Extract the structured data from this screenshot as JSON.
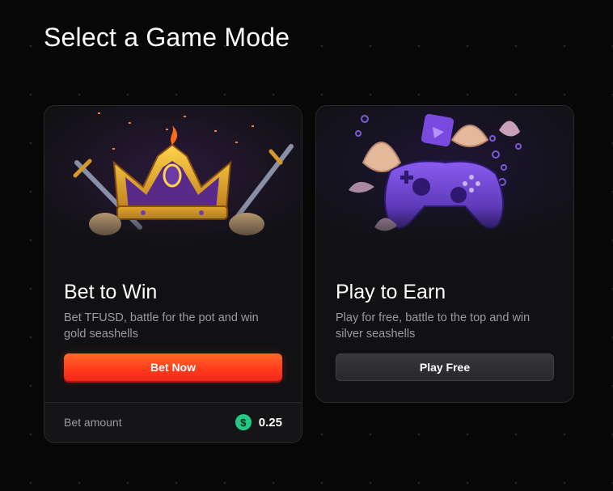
{
  "page": {
    "title": "Select a Game Mode"
  },
  "modes": [
    {
      "title": "Bet to Win",
      "description": "Bet TFUSD, battle for the pot and win gold seashells",
      "button_label": "Bet Now",
      "art": "crown-with-swords-illustration",
      "footer": {
        "label": "Bet amount",
        "value": "0.25",
        "currency_icon": "dollar-coin-icon"
      }
    },
    {
      "title": "Play to Earn",
      "description": "Play for free, battle to the top and win silver seashells",
      "button_label": "Play Free",
      "art": "game-controller-with-seashells-illustration"
    }
  ],
  "colors": {
    "background": "#070708",
    "card": "#111114",
    "bet_button": "#ff4a1f",
    "play_button": "#2f2f33",
    "coin": "#22c983",
    "muted_text": "#9a9aa2"
  }
}
